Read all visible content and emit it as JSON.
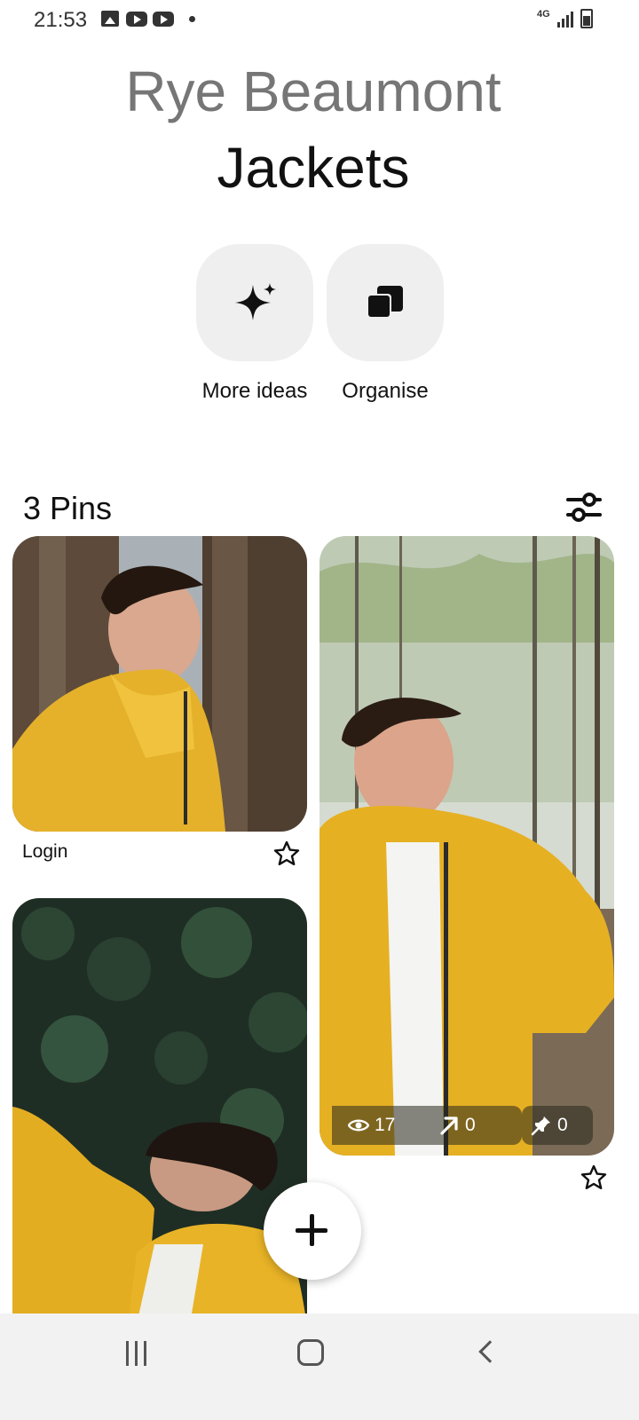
{
  "status_bar": {
    "time": "21:53",
    "network": "4G",
    "icons": [
      "gallery-icon",
      "youtube-icon",
      "youtube-icon",
      "dot-icon",
      "signal-icon",
      "battery-icon"
    ]
  },
  "header": {
    "owner_name": "Rye Beaumont",
    "board_title": "Jackets"
  },
  "actions": [
    {
      "label": "More ideas",
      "icon": "sparkle-icon"
    },
    {
      "label": "Organise",
      "icon": "organise-icon"
    }
  ],
  "pins_section": {
    "count_label": "3 Pins",
    "filter_icon": "filter-sliders-icon"
  },
  "pins": [
    {
      "caption": "Login",
      "icon": "star-icon"
    },
    {
      "stats": {
        "views": "17",
        "outbound_clicks": "0",
        "saves": "0"
      },
      "icon": "star-icon"
    },
    {}
  ],
  "fab": {
    "icon": "plus-icon"
  },
  "navigation": {
    "icons": [
      "recents-icon",
      "home-icon",
      "back-icon"
    ]
  },
  "colors": {
    "owner_text": "#767676",
    "action_bg": "#efefef",
    "jacket_yellow": "#e9b21f",
    "nav_bg": "#f2f2f2"
  }
}
